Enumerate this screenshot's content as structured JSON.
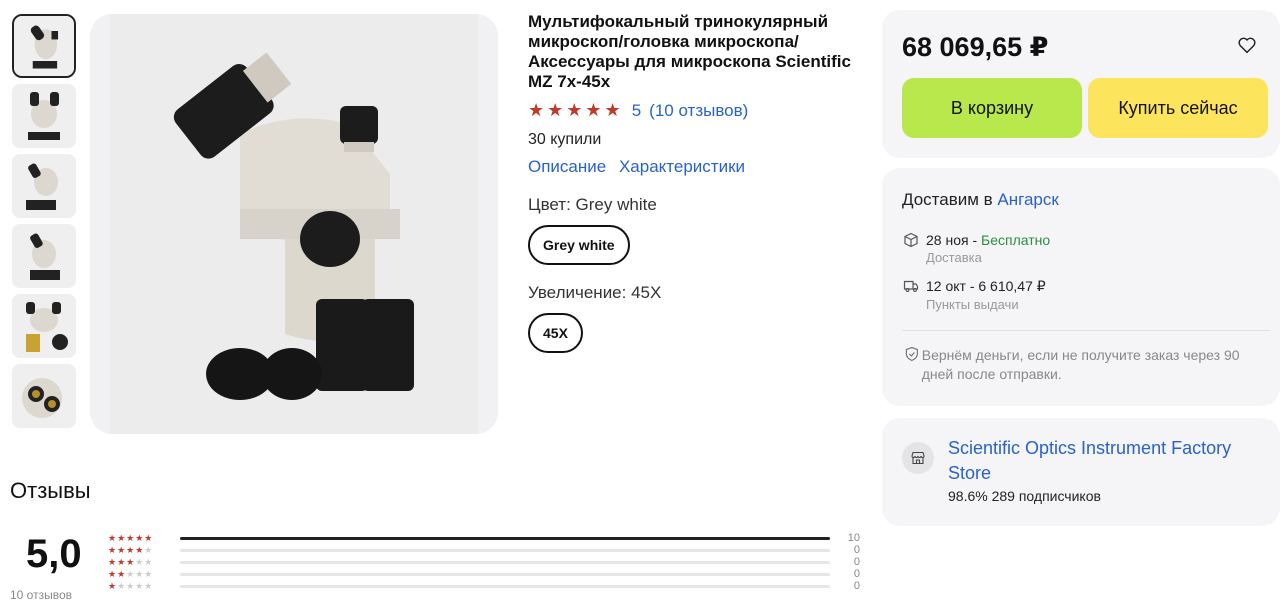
{
  "product": {
    "title": "Мультифокальный тринокулярный микроскоп/головка микроскопа/ Аксессуары для микроскопа Scientific MZ 7x-45x",
    "rating_value": "5",
    "reviews_link": "(10 отзывов)",
    "bought": "30 купили",
    "tab_description": "Описание",
    "tab_specs": "Характеристики",
    "color_label": "Цвет: Grey white",
    "color_option": "Grey white",
    "zoom_label": "Увеличение: 45X",
    "zoom_option": "45X"
  },
  "purchase": {
    "price": "68 069,65 ₽",
    "cart_button": "В корзину",
    "buy_now_button": "Купить сейчас"
  },
  "delivery": {
    "title_prefix": "Доставим в ",
    "city": "Ангарск",
    "option1_date": "28 ноя - ",
    "option1_price": "Бесплатно",
    "option1_sub": "Доставка",
    "option2_text": "12 окт - 6 610,47 ₽",
    "option2_sub": "Пункты выдачи",
    "guarantee": "Вернём деньги, если не получите заказ через 90 дней после отправки."
  },
  "store": {
    "name": "Scientific Optics Instrument Factory Store",
    "stats": "98.6%  289 подписчиков"
  },
  "reviews": {
    "title": "Отзывы",
    "average": "5,0",
    "count": "10 отзывов",
    "distribution": [
      {
        "stars": 5,
        "count": "10",
        "fraction": 1.0
      },
      {
        "stars": 4,
        "count": "0",
        "fraction": 0
      },
      {
        "stars": 3,
        "count": "0",
        "fraction": 0
      },
      {
        "stars": 2,
        "count": "0",
        "fraction": 0
      },
      {
        "stars": 1,
        "count": "0",
        "fraction": 0
      }
    ]
  },
  "colors": {
    "accent_link": "#2962c7",
    "star": "#c0392b",
    "cart_button": "#b9e84c",
    "buy_button": "#fce45c",
    "free_delivery": "#2a8f3a"
  }
}
